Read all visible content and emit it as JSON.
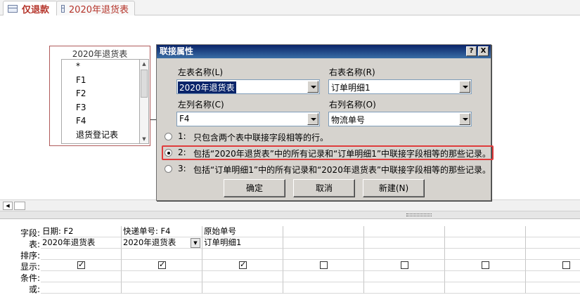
{
  "tabs": [
    {
      "label": "仅退款",
      "active": true
    },
    {
      "label": "2020年退货表",
      "active": false
    }
  ],
  "table_box": {
    "title": "2020年退货表",
    "fields": [
      "*",
      "F1",
      "F2",
      "F3",
      "F4",
      "退货登记表"
    ]
  },
  "dialog": {
    "title": "联接属性",
    "help_btn": "?",
    "close_btn": "X",
    "left_table_label": "左表名称(L)",
    "left_table_value": "2020年退货表",
    "right_table_label": "右表名称(R)",
    "right_table_value": "订单明细1",
    "left_col_label": "左列名称(C)",
    "left_col_value": "F4",
    "right_col_label": "右列名称(O)",
    "right_col_value": "物流单号",
    "options": [
      {
        "num": "1:",
        "text": "只包含两个表中联接字段相等的行。",
        "selected": false
      },
      {
        "num": "2:",
        "text": "包括“2020年退货表”中的所有记录和“订单明细1”中联接字段相等的那些记录。",
        "selected": true
      },
      {
        "num": "3:",
        "text": "包括“订单明细1”中的所有记录和“2020年退货表”中联接字段相等的那些记录。",
        "selected": false
      }
    ],
    "ok_label": "确定",
    "cancel_label": "取消",
    "new_label": "新建(N)"
  },
  "grid": {
    "row_headers": [
      "字段:",
      "表:",
      "排序:",
      "显示:",
      "条件:",
      "或:"
    ],
    "columns": [
      {
        "field": "日期: F2",
        "table": "2020年退货表",
        "show": true
      },
      {
        "field": "快递单号: F4",
        "table": "2020年退货表",
        "show": true
      },
      {
        "field": "原始单号",
        "table": "订单明细1",
        "show": true
      },
      {
        "field": "",
        "table": "",
        "show": false
      },
      {
        "field": "",
        "table": "",
        "show": false
      },
      {
        "field": "",
        "table": "",
        "show": false
      },
      {
        "field": "",
        "table": "",
        "show": false
      }
    ]
  },
  "colors": {
    "highlight": "#e03c3c",
    "tab_text": "#b5342a",
    "title_bar": "#0a246a"
  }
}
